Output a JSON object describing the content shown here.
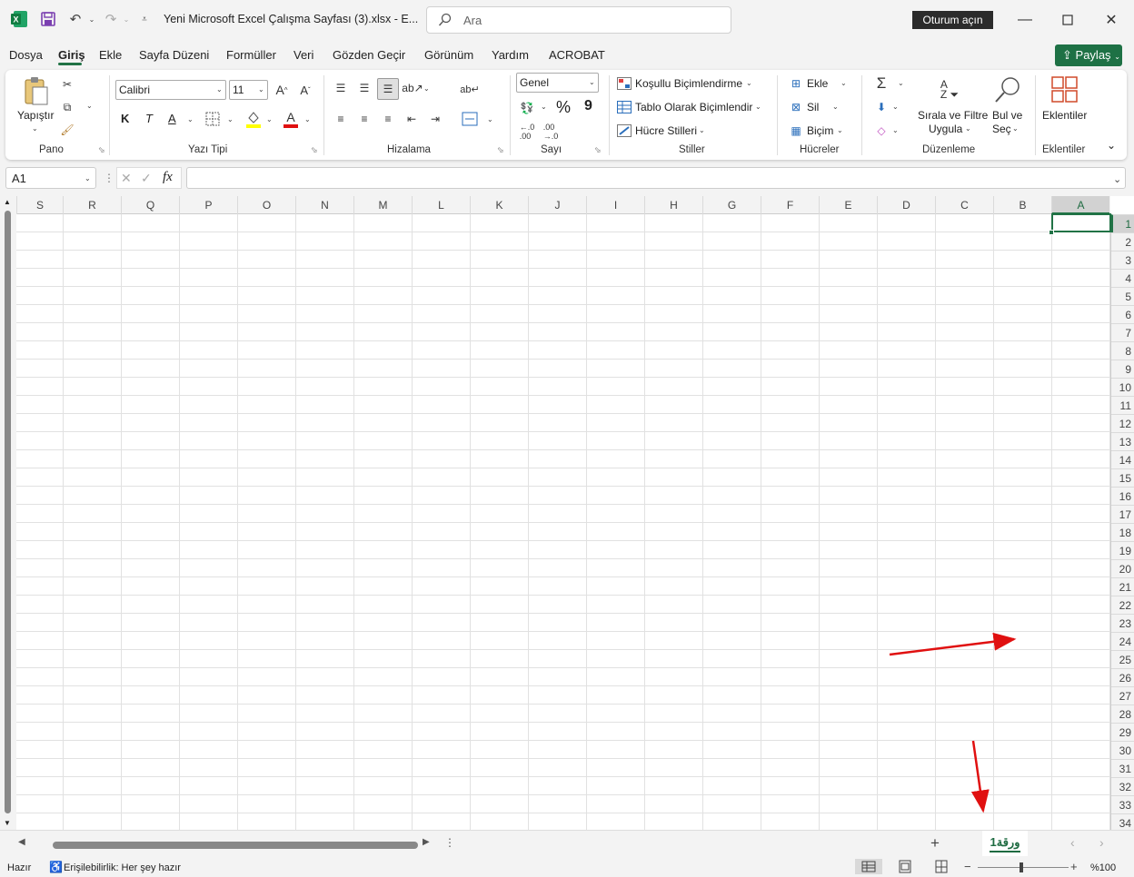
{
  "window": {
    "title": "Yeni Microsoft Excel Çalışma Sayfası (3).xlsx  -  E...",
    "signin": "Oturum açın",
    "search_placeholder": "Ara"
  },
  "menus": [
    "Dosya",
    "Giriş",
    "Ekle",
    "Sayfa Düzeni",
    "Formüller",
    "Veri",
    "Gözden Geçir",
    "Görünüm",
    "Yardım",
    "ACROBAT"
  ],
  "share": "Paylaş",
  "ribbon": {
    "clipboard": {
      "paste": "Yapıştır",
      "label": "Pano"
    },
    "font": {
      "name": "Calibri",
      "size": "11",
      "label": "Yazı Tipi",
      "bold": "K",
      "italic": "T",
      "underline": "A"
    },
    "alignment": {
      "label": "Hizalama"
    },
    "number": {
      "format": "Genel",
      "label": "Sayı",
      "percent": "%",
      "comma": "9"
    },
    "styles": {
      "conditional": "Koşullu Biçimlendirme",
      "table": "Tablo Olarak Biçimlendir",
      "cell": "Hücre Stilleri",
      "label": "Stiller"
    },
    "cells": {
      "insert": "Ekle",
      "delete": "Sil",
      "format": "Biçim",
      "label": "Hücreler"
    },
    "editing": {
      "sort1": "Sırala ve Filtre",
      "sort2": "Uygula",
      "find1": "Bul ve",
      "find2": "Seç",
      "label": "Düzenleme"
    },
    "addins": {
      "button": "Eklentiler",
      "label": "Eklentiler"
    }
  },
  "namebox": "A1",
  "columns": [
    "S",
    "R",
    "Q",
    "P",
    "O",
    "N",
    "M",
    "L",
    "K",
    "J",
    "I",
    "H",
    "G",
    "F",
    "E",
    "D",
    "C",
    "B",
    "A"
  ],
  "rows": [
    "1",
    "2",
    "3",
    "4",
    "5",
    "6",
    "7",
    "8",
    "9",
    "10",
    "11",
    "12",
    "13",
    "14",
    "15",
    "16",
    "17",
    "18",
    "19",
    "20",
    "21",
    "22",
    "23",
    "24",
    "25",
    "26",
    "27",
    "28",
    "29",
    "30",
    "31",
    "32",
    "33",
    "34"
  ],
  "sheet_tab": "ورقة1",
  "status": {
    "ready": "Hazır",
    "accessibility": "Erişilebilirlik: Her şey hazır",
    "zoom": "%100"
  },
  "colors": {
    "accent": "#217346",
    "arrow": "#e01010"
  }
}
